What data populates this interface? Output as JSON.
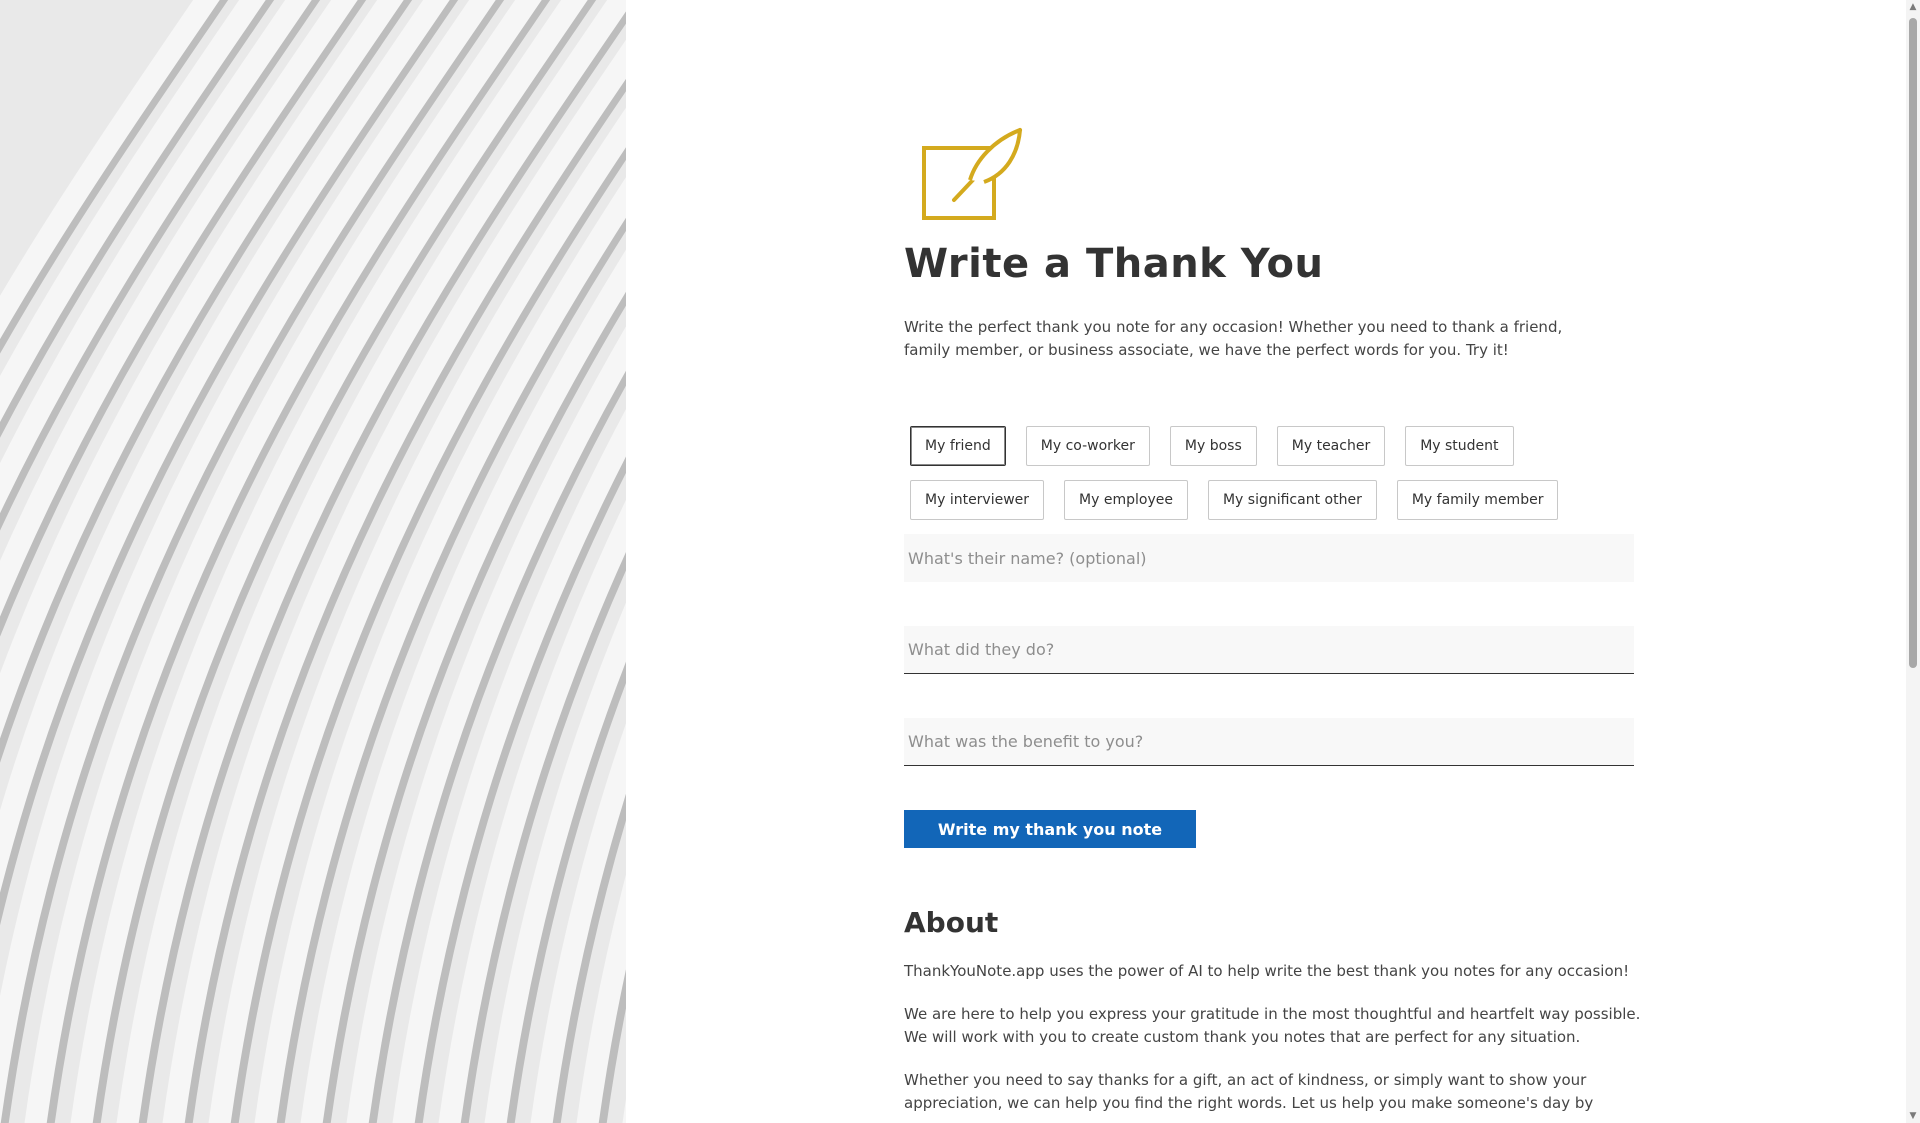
{
  "page": {
    "title": "Write a Thank You",
    "intro": "Write the perfect thank you note for any occasion! Whether you need to thank a friend, family member, or business associate, we have the perfect words for you. Try it!"
  },
  "recipients": {
    "row1": [
      "My friend",
      "My co-worker",
      "My boss",
      "My teacher",
      "My student"
    ],
    "row2": [
      "My interviewer",
      "My employee",
      "My significant other",
      "My family member"
    ],
    "selected": "My friend"
  },
  "form": {
    "name_placeholder": "What's their name? (optional)",
    "deed_placeholder": "What did they do?",
    "benefit_placeholder": "What was the benefit to you?",
    "name_value": "",
    "deed_value": "",
    "benefit_value": "",
    "submit_label": "Write my thank you note"
  },
  "about": {
    "title": "About",
    "paragraphs": [
      "ThankYouNote.app uses the power of AI to help write the best thank you notes for any occasion!",
      "We are here to help you express your gratitude in the most thoughtful and heartfelt way possible. We will work with you to create custom thank you notes that are perfect for any situation.",
      "Whether you need to say thanks for a gift, an act of kindness, or simply want to show your appreciation, we can help you find the right words. Let us help you make someone's day by"
    ]
  },
  "icons": {
    "logo": "quill-note-icon",
    "scroll_up": "scroll-up-arrow-icon",
    "scroll_down": "scroll-down-arrow-icon"
  },
  "colors": {
    "accent": "#d4aa1e",
    "button": "#1266b8",
    "text": "#333333",
    "field_bg": "#f8f8f8"
  }
}
